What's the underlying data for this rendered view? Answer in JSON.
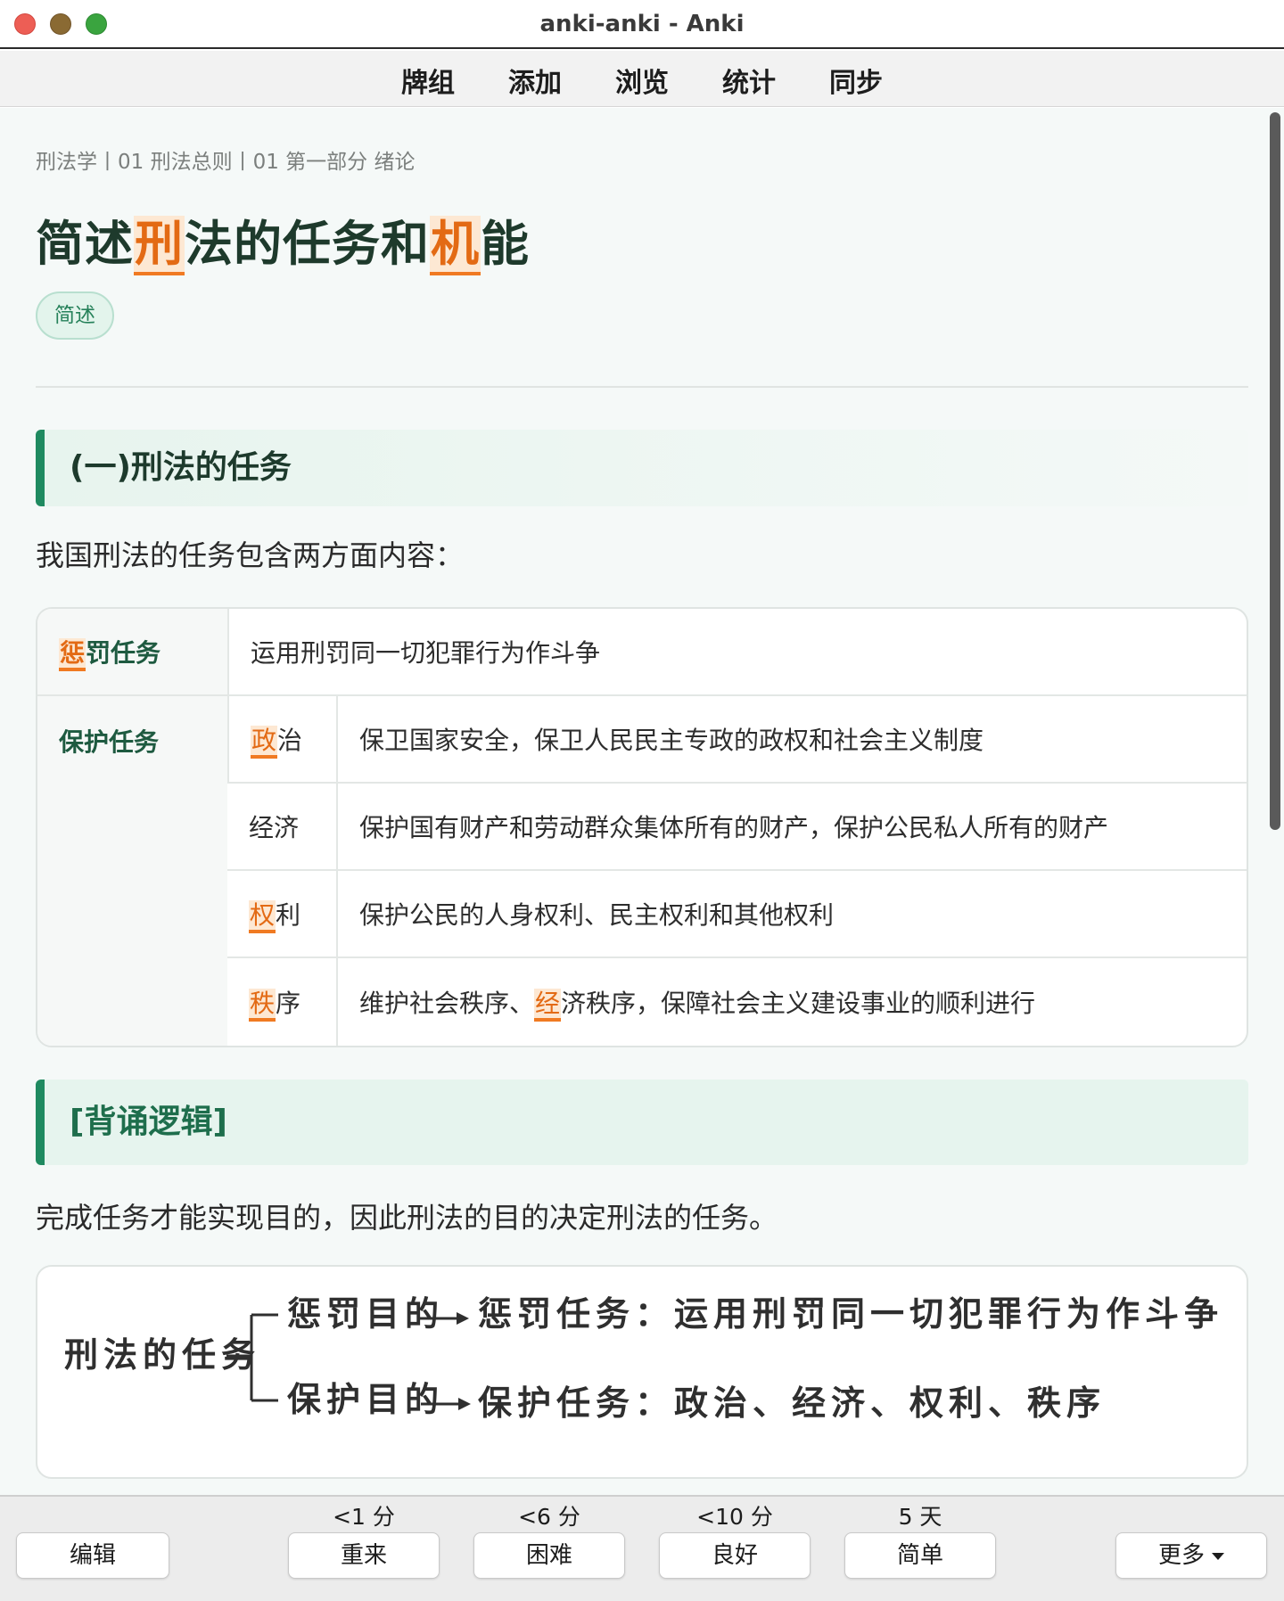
{
  "window": {
    "title": "anki-anki - Anki"
  },
  "toolbar": {
    "items": [
      "牌组",
      "添加",
      "浏览",
      "统计",
      "同步"
    ]
  },
  "card": {
    "breadcrumb": "刑法学丨01 刑法总则丨01 第一部分 绪论",
    "title_parts": [
      "简述",
      "刑",
      "法的任务和",
      "机",
      "能"
    ],
    "tag": "简述",
    "section1": {
      "heading": "(一)刑法的任务",
      "intro": "我国刑法的任务包含两方面内容："
    },
    "table": {
      "punish": {
        "label_hl": "惩",
        "label_rest": "罚任务",
        "desc": "运用刑罚同一切犯罪行为作斗争"
      },
      "protect": {
        "label": "保护任务",
        "rows": [
          {
            "sub_hl": "政",
            "sub_rest": "治",
            "desc_pre": "保卫国家安全，保卫人民民主专政的政权和社会主义制度",
            "desc_hl": "",
            "desc_post": ""
          },
          {
            "sub_hl": "",
            "sub_rest": "经济",
            "desc_pre": "保护国有财产和劳动群众集体所有的财产，保护公民私人所有的财产",
            "desc_hl": "",
            "desc_post": ""
          },
          {
            "sub_hl": "权",
            "sub_rest": "利",
            "desc_pre": "保护公民的人身权利、民主权利和其他权利",
            "desc_hl": "",
            "desc_post": ""
          },
          {
            "sub_hl": "秩",
            "sub_rest": "序",
            "desc_pre": "维护社会秩序、",
            "desc_hl": "经",
            "desc_post": "济秩序，保障社会主义建设事业的顺利进行"
          }
        ]
      }
    },
    "section2": {
      "heading": "[背诵逻辑]",
      "text": "完成任务才能实现目的，因此刑法的目的决定刑法的任务。"
    },
    "diagram": {
      "root": "刑法的任务",
      "branch1_label": "惩罚目的",
      "branch1_result": "惩罚任务：运用刑罚同一切犯罪行为作斗争",
      "branch2_label": "保护目的",
      "branch2_result": "保护任务：政治、经济、权利、秩序"
    }
  },
  "answer_bar": {
    "edit": "编辑",
    "more": "更多",
    "buttons": [
      {
        "label": "重来",
        "interval": "<1 分"
      },
      {
        "label": "困难",
        "interval": "<6 分"
      },
      {
        "label": "良好",
        "interval": "<10 分"
      },
      {
        "label": "简单",
        "interval": "5 天"
      }
    ]
  },
  "colors": {
    "accent_green": "#1f8a60",
    "highlight_orange": "#e36a14",
    "highlight_bg": "#fde8d3"
  }
}
